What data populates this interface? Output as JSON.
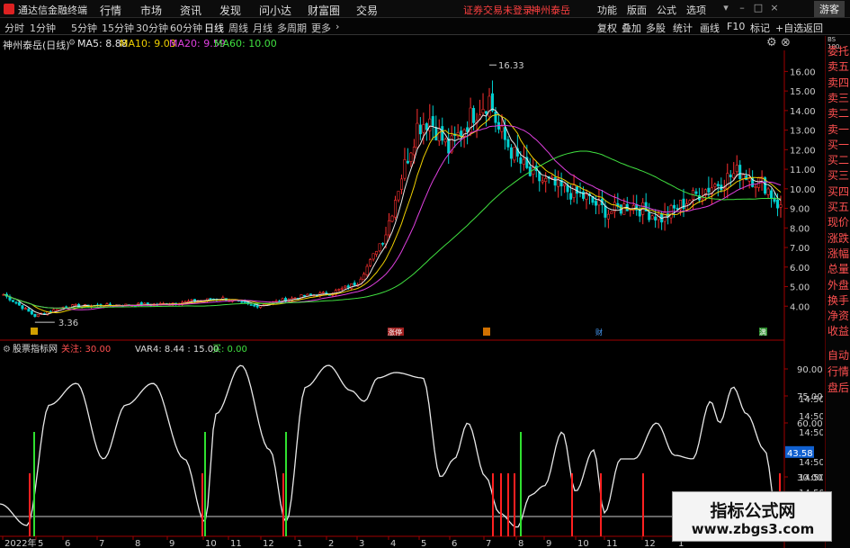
{
  "app": {
    "name": "通达信金融终端"
  },
  "menu": [
    "行情",
    "市场",
    "资讯",
    "发现",
    "问小达",
    "财富圈",
    "交易"
  ],
  "status": {
    "trade": "证券交易未登录",
    "stock": "神州泰岳"
  },
  "right_menu": [
    "功能",
    "版面",
    "公式",
    "选项"
  ],
  "guest": "游客",
  "periods": [
    "分时",
    "1分钟",
    "5分钟",
    "15分钟",
    "30分钟",
    "60分钟",
    "日线",
    "周线",
    "月线",
    "多周期",
    "更多"
  ],
  "active_period": "日线",
  "toolbar": [
    "复权",
    "叠加",
    "多股",
    "统计",
    "画线",
    "F10",
    "标记",
    "+自选",
    "返回"
  ],
  "stock_title": "神州泰岳(日线)",
  "ma": [
    {
      "label": "MA5: 8.88",
      "color": "#e8e8e8"
    },
    {
      "label": "MA10: 9.03",
      "color": "#f0d000"
    },
    {
      "label": "MA20: 9.59",
      "color": "#e040e0"
    },
    {
      "label": "MA60: 10.00",
      "color": "#40e040"
    }
  ],
  "price_axis": [
    "16.00",
    "15.00",
    "14.00",
    "13.00",
    "12.00",
    "11.00",
    "10.00",
    "9.00",
    "8.00",
    "7.00",
    "6.00",
    "5.00",
    "4.00"
  ],
  "annotations": {
    "high": "16.33",
    "low": "3.36"
  },
  "event_markers": [
    "涨停",
    "财",
    "满"
  ],
  "indicator": {
    "name": "股票指标网",
    "follow": "关注: 30.00",
    "var4": "VAR4: 8.44 : 15.00",
    "buy": "买: 0.00",
    "axis": [
      "90.00",
      "75.00",
      "60.00",
      "30.00"
    ],
    "current": "43.58",
    "time_labels": [
      "14:50",
      "14:50",
      "14:50",
      "14:50",
      "14:50",
      "14:50"
    ]
  },
  "date_axis": [
    "2022年",
    "5",
    "6",
    "7",
    "8",
    "9",
    "10",
    "11",
    "12",
    "1",
    "2",
    "3",
    "4",
    "5",
    "6",
    "7",
    "8",
    "9",
    "10",
    "11",
    "12",
    "1"
  ],
  "sidebar": {
    "top_small": [
      "BS",
      "100"
    ],
    "items": [
      "委托",
      "卖五",
      "卖四",
      "卖三",
      "卖二",
      "卖一",
      "买一",
      "买二",
      "买三",
      "买四",
      "买五",
      "现价",
      "涨跌",
      "涨幅",
      "总量",
      "外盘",
      "换手",
      "净资",
      "收益"
    ],
    "bottom": [
      "自动",
      "行情",
      "盘后"
    ]
  },
  "watermark": {
    "line1": "指标公式网",
    "line2": "www.zbgs3.com"
  },
  "colors": {
    "up": "#ff3030",
    "down": "#00d0d0",
    "ma5": "#e8e8e8",
    "ma10": "#f0d000",
    "ma20": "#e040e0",
    "ma60": "#40e040",
    "axis": "#a00000"
  }
}
